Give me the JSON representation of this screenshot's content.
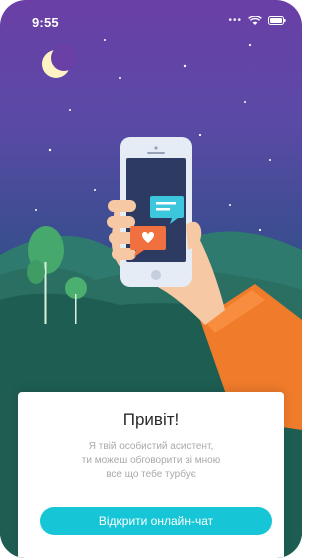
{
  "status_bar": {
    "time": "9:55",
    "icons": [
      "signal-dots-icon",
      "wifi-icon",
      "battery-icon"
    ]
  },
  "welcome_card": {
    "title": "Привіт!",
    "subtitle_lines": [
      "Я твій особистий асистент,",
      "ти можеш обговорити зі мною",
      "все що тебе турбує"
    ],
    "open_chat_button": "Відкрити онлайн-чат"
  },
  "illustration": {
    "elements": [
      "moon-icon",
      "stars",
      "hand-holding-phone",
      "chat-bubble-icon",
      "heart-bubble-icon",
      "hills",
      "trees"
    ]
  },
  "colors": {
    "sky_top": "#6a3fa6",
    "button": "#16c6d6",
    "sleeve": "#f07b2b",
    "hill_dark": "#1e5e52"
  }
}
